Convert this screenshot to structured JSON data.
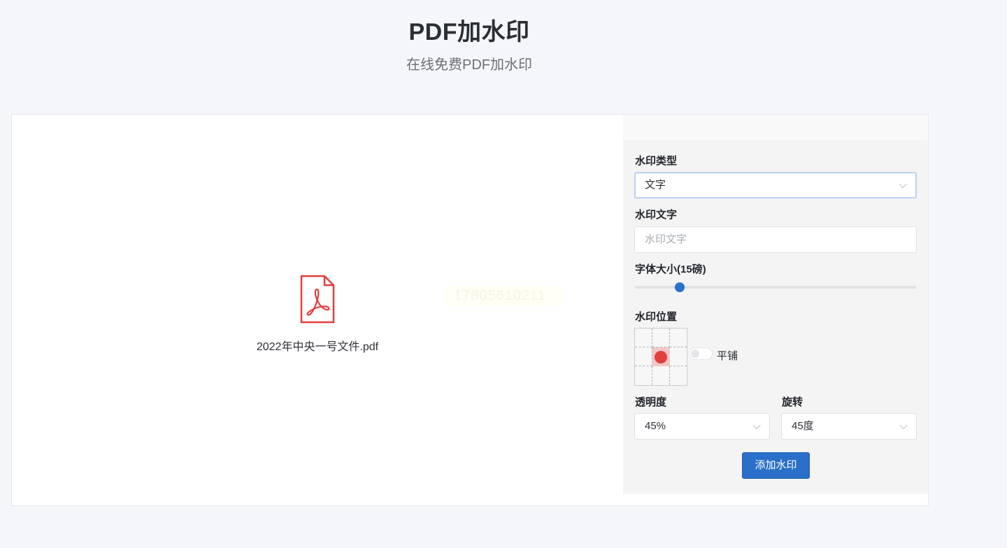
{
  "header": {
    "title": "PDF加水印",
    "subtitle": "在线免费PDF加水印"
  },
  "preview": {
    "file_name": "2022年中央一号文件.pdf",
    "watermark_preview_text": "17805610211",
    "icon": "pdf-file-icon",
    "accent_color": "#e33d3d"
  },
  "settings": {
    "watermark_type_label": "水印类型",
    "watermark_type_value": "文字",
    "watermark_text_label": "水印文字",
    "watermark_text_placeholder": "水印文字",
    "font_size_label": "字体大小(15磅)",
    "font_size_fraction": 0.16,
    "position_label": "水印位置",
    "position_selected": "middle-center",
    "tile_label": "平铺",
    "tile_enabled": false,
    "opacity_label": "透明度",
    "opacity_value": "45%",
    "rotation_label": "旋转",
    "rotation_value": "45度",
    "submit_label": "添加水印",
    "primary_color": "#2a6fc9"
  }
}
